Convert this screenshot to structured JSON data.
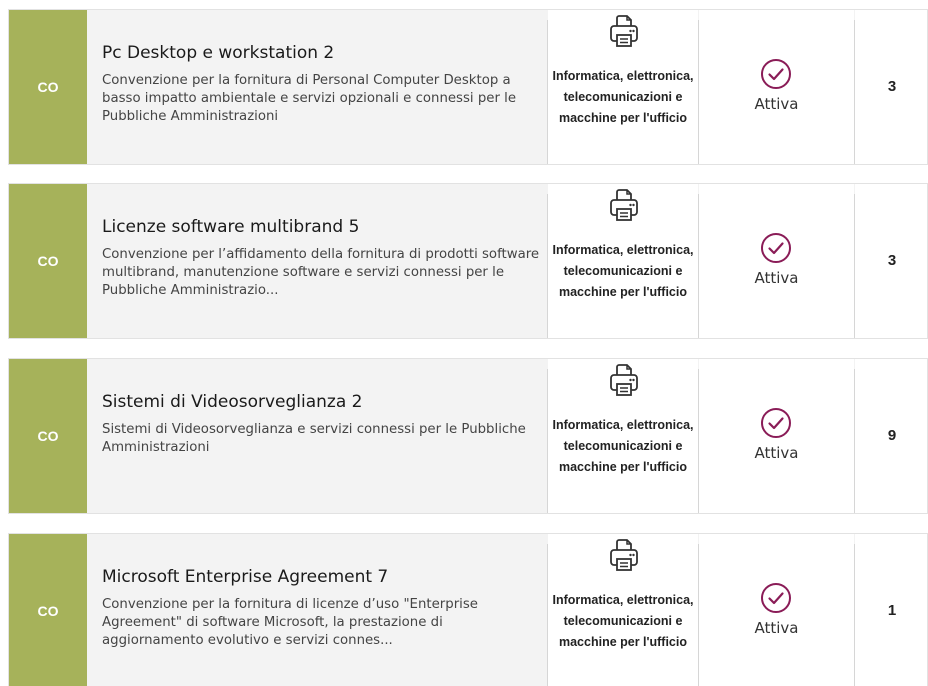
{
  "colors": {
    "badge_background": "#a6b25a",
    "status_icon": "#8a1c57"
  },
  "icons": {
    "category": "printer-icon",
    "status": "check-circle-icon"
  },
  "items": [
    {
      "badge": "CO",
      "title": "Pc Desktop e workstation 2",
      "description": "Convenzione per la fornitura di Personal Computer Desktop a basso impatto ambientale e servizi opzionali e connessi per le Pubbliche Amministrazioni",
      "category": "Informatica, elettronica, telecomunicazioni e macchine per l'ufficio",
      "status": "Attiva",
      "count": "3"
    },
    {
      "badge": "CO",
      "title": "Licenze software multibrand 5",
      "description": "Convenzione per l’affidamento della fornitura di prodotti software multibrand, manutenzione software e servizi connessi per le Pubbliche Amministrazio...",
      "category": "Informatica, elettronica, telecomunicazioni e macchine per l'ufficio",
      "status": "Attiva",
      "count": "3"
    },
    {
      "badge": "CO",
      "title": "Sistemi di Videosorveglianza 2",
      "description": "Sistemi di Videosorveglianza e servizi connessi per le Pubbliche Amministrazioni",
      "category": "Informatica, elettronica, telecomunicazioni e macchine per l'ufficio",
      "status": "Attiva",
      "count": "9"
    },
    {
      "badge": "CO",
      "title": "Microsoft Enterprise Agreement 7",
      "description": "Convenzione per la fornitura di licenze d’uso \"Enterprise Agreement\" di software Microsoft, la prestazione di aggiornamento evolutivo e servizi connes...",
      "category": "Informatica, elettronica, telecomunicazioni e macchine per l'ufficio",
      "status": "Attiva",
      "count": "1"
    }
  ]
}
